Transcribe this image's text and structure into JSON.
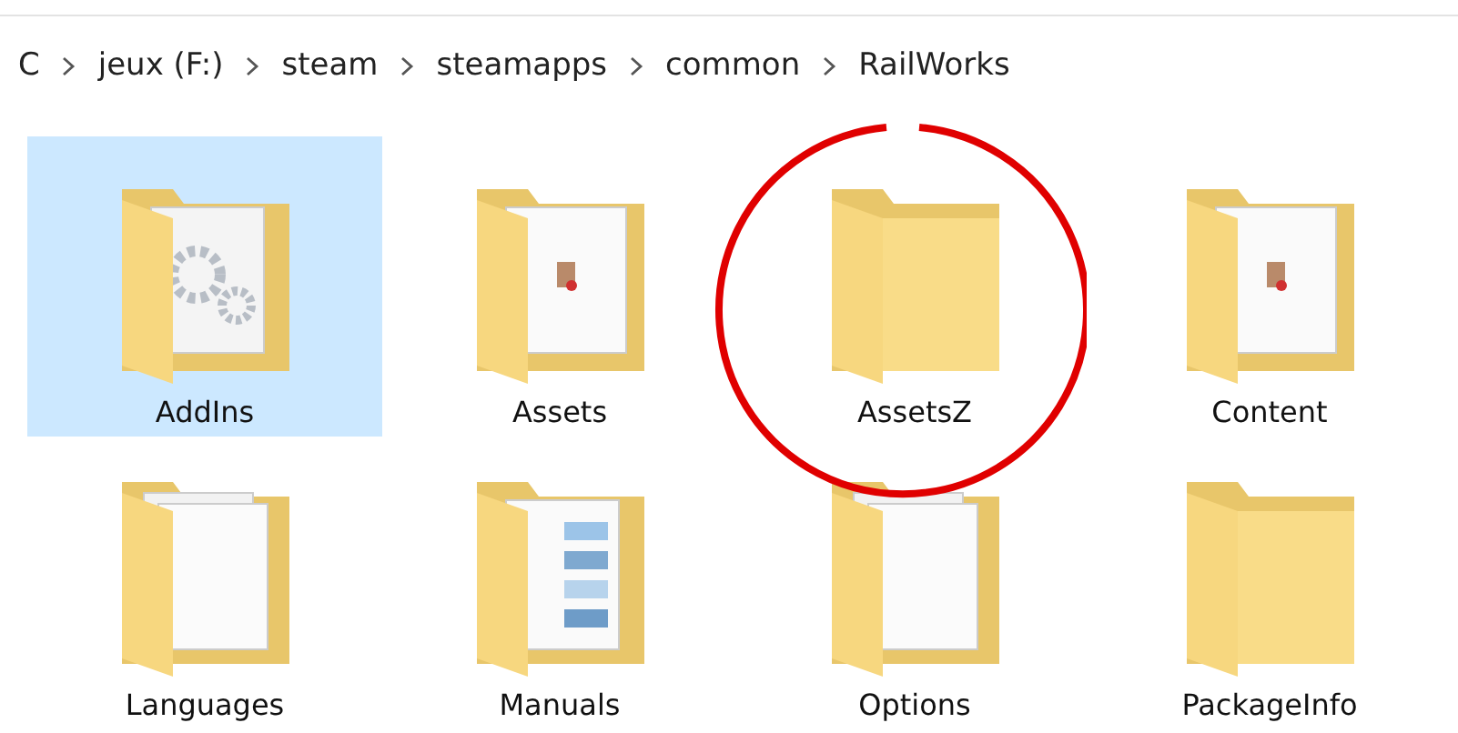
{
  "breadcrumb": [
    {
      "label": "C"
    },
    {
      "label": "jeux (F:)"
    },
    {
      "label": "steam"
    },
    {
      "label": "steamapps"
    },
    {
      "label": "common"
    },
    {
      "label": "RailWorks"
    }
  ],
  "folders": [
    {
      "name": "AddIns",
      "kind": "gears",
      "selected": true
    },
    {
      "name": "Assets",
      "kind": "document",
      "selected": false
    },
    {
      "name": "AssetsZ",
      "kind": "empty",
      "selected": false
    },
    {
      "name": "Content",
      "kind": "document",
      "selected": false
    },
    {
      "name": "Languages",
      "kind": "papers",
      "selected": false
    },
    {
      "name": "Manuals",
      "kind": "photos",
      "selected": false
    },
    {
      "name": "Options",
      "kind": "papers",
      "selected": false
    },
    {
      "name": "PackageInfo",
      "kind": "empty",
      "selected": false
    }
  ]
}
